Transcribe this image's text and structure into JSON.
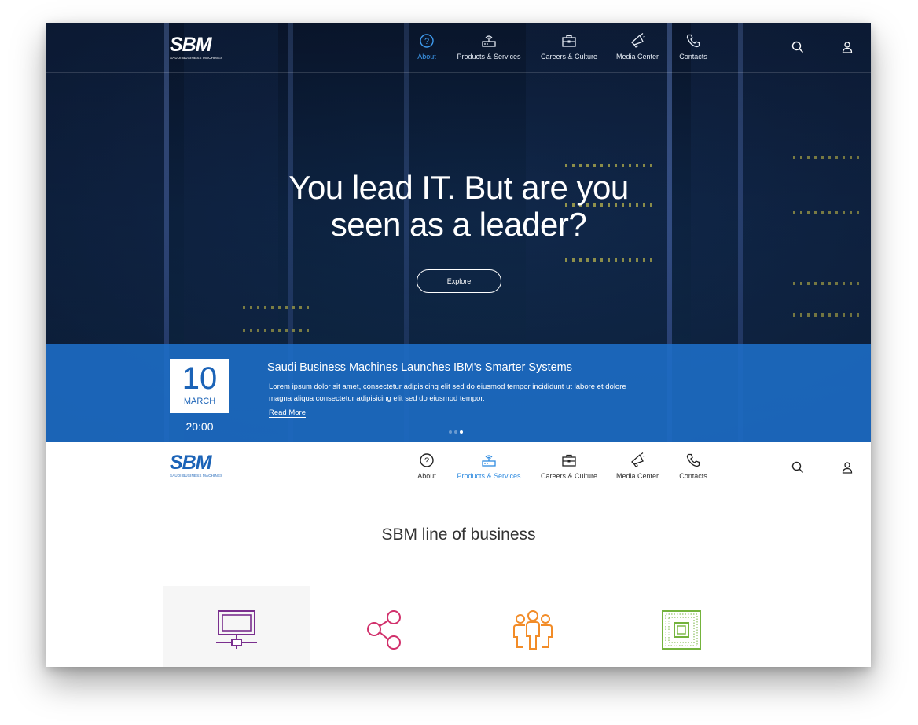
{
  "brand": {
    "logo_text": "SBM",
    "logo_subtext": "SAUDI BUSINESS MACHINES"
  },
  "nav": {
    "items": [
      {
        "label": "About",
        "icon": "question-circle-icon"
      },
      {
        "label": "Products & Services",
        "icon": "router-icon"
      },
      {
        "label": "Careers & Culture",
        "icon": "briefcase-icon"
      },
      {
        "label": "Media Center",
        "icon": "megaphone-icon"
      },
      {
        "label": "Contacts",
        "icon": "phone-icon"
      }
    ],
    "hero_active": "About",
    "sticky_active": "Products & Services",
    "search_icon": "search-icon",
    "account_icon": "user-icon"
  },
  "hero": {
    "headline_line1": "You lead IT. But are you",
    "headline_line2": "seen as a leader?",
    "cta_label": "Explore"
  },
  "news": {
    "day": "10",
    "month": "MARCH",
    "time": "20:00",
    "title": "Saudi Business Machines Launches IBM's Smarter Systems",
    "body": "Lorem ipsum dolor sit amet, consectetur adipisicing elit sed do eiusmod tempor incididunt ut labore et dolore magna aliqua consectetur adipisicing elit sed do eiusmod tempor.",
    "read_more": "Read More",
    "slides_total": 3,
    "slide_active": 3
  },
  "business": {
    "section_title": "SBM line of business",
    "tiles": [
      {
        "icon": "computer-network-icon",
        "color": "#7a2f8e"
      },
      {
        "icon": "share-nodes-icon",
        "color": "#d1306b"
      },
      {
        "icon": "people-group-icon",
        "color": "#f28c28"
      },
      {
        "icon": "chip-icon",
        "color": "#74b33d"
      }
    ]
  },
  "colors": {
    "accent_blue": "#2f8be0",
    "news_band": "#1e6ec8",
    "logo_blue": "#1b63b7"
  }
}
